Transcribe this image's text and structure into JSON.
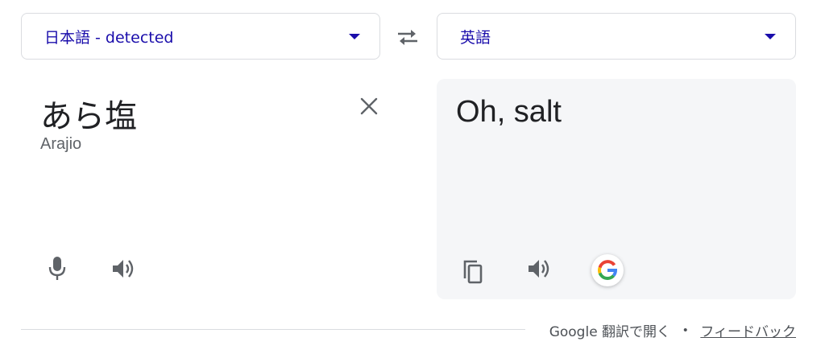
{
  "source_language": {
    "label": "日本語 - detected"
  },
  "target_language": {
    "label": "英語"
  },
  "source": {
    "text": "あら塩",
    "romanization": "Arajio"
  },
  "target": {
    "text": "Oh, salt"
  },
  "footer": {
    "open_in_translate": "Google 翻訳で開く",
    "separator": "•",
    "feedback": "フィードバック"
  },
  "colors": {
    "link_blue": "#1a0dab",
    "icon_gray": "#5f6368",
    "panel_bg": "#f5f6f8",
    "border": "#dadce0"
  },
  "icons": [
    "swap-icon",
    "close-icon",
    "mic-icon",
    "speaker-icon",
    "copy-icon",
    "google-g-icon",
    "chevron-down-icon"
  ]
}
